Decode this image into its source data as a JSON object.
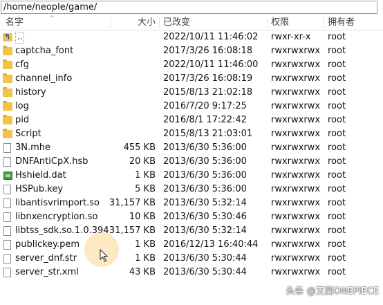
{
  "path": "/home/neople/game/",
  "columns": {
    "name": "名字",
    "size": "大小",
    "date": "已改变",
    "perm": "权限",
    "owner": "拥有者"
  },
  "files": [
    {
      "icon": "parent-folder-icon",
      "name": "..",
      "size": "",
      "date": "2022/10/11 11:46:02",
      "perm": "rwxr-xr-x",
      "owner": "root"
    },
    {
      "icon": "folder-icon",
      "name": "captcha_font",
      "size": "",
      "date": "2017/3/26 16:08:18",
      "perm": "rwxrwxrwx",
      "owner": "root"
    },
    {
      "icon": "folder-icon",
      "name": "cfg",
      "size": "",
      "date": "2022/10/11 11:46:00",
      "perm": "rwxrwxrwx",
      "owner": "root"
    },
    {
      "icon": "folder-icon",
      "name": "channel_info",
      "size": "",
      "date": "2017/3/26 16:08:19",
      "perm": "rwxrwxrwx",
      "owner": "root"
    },
    {
      "icon": "folder-icon",
      "name": "history",
      "size": "",
      "date": "2015/8/13 21:02:18",
      "perm": "rwxrwxrwx",
      "owner": "root"
    },
    {
      "icon": "folder-icon",
      "name": "log",
      "size": "",
      "date": "2016/7/20 9:17:25",
      "perm": "rwxrwxrwx",
      "owner": "root"
    },
    {
      "icon": "folder-icon",
      "name": "pid",
      "size": "",
      "date": "2016/8/1 17:22:42",
      "perm": "rwxrwxrwx",
      "owner": "root"
    },
    {
      "icon": "folder-icon",
      "name": "Script",
      "size": "",
      "date": "2015/8/13 21:03:01",
      "perm": "rwxrwxrwx",
      "owner": "root"
    },
    {
      "icon": "file-icon",
      "name": "3N.mhe",
      "size": "455 KB",
      "date": "2013/6/30 5:36:00",
      "perm": "rwxrwxrwx",
      "owner": "root"
    },
    {
      "icon": "file-icon",
      "name": "DNFAntiCpX.hsb",
      "size": "20 KB",
      "date": "2013/6/30 5:36:00",
      "perm": "rwxrwxrwx",
      "owner": "root"
    },
    {
      "icon": "dat-file-icon",
      "name": "Hshield.dat",
      "size": "1 KB",
      "date": "2013/6/30 5:36:00",
      "perm": "rwxrwxrwx",
      "owner": "root"
    },
    {
      "icon": "file-icon",
      "name": "HSPub.key",
      "size": "5 KB",
      "date": "2013/6/30 5:36:00",
      "perm": "rwxrwxrwx",
      "owner": "root"
    },
    {
      "icon": "file-icon",
      "name": "libantisvrimport.so",
      "size": "31,157 KB",
      "date": "2013/6/30 5:32:14",
      "perm": "rwxrwxrwx",
      "owner": "root"
    },
    {
      "icon": "file-icon",
      "name": "libnxencryption.so",
      "size": "10 KB",
      "date": "2013/6/30 5:30:46",
      "perm": "rwxrwxrwx",
      "owner": "root"
    },
    {
      "icon": "file-icon",
      "name": "libtss_sdk.so.1.0.394",
      "size": "31,157 KB",
      "date": "2013/6/30 5:32:14",
      "perm": "rwxrwxrwx",
      "owner": "root"
    },
    {
      "icon": "file-icon",
      "name": "publickey.pem",
      "size": "1 KB",
      "date": "2016/12/13 16:40:44",
      "perm": "rwxrwxrwx",
      "owner": "root"
    },
    {
      "icon": "file-icon",
      "name": "server_dnf.str",
      "size": "1 KB",
      "date": "2013/6/30 5:30:44",
      "perm": "rwxrwxrwx",
      "owner": "root"
    },
    {
      "icon": "file-icon",
      "name": "server_str.xml",
      "size": "43 KB",
      "date": "2013/6/30 5:30:44",
      "perm": "rwxrwxrwx",
      "owner": "root"
    }
  ],
  "watermark": "头条 @艾西ONEPIECE",
  "colors": {
    "folder": "#f2c34a",
    "highlight": "#f8ce78"
  }
}
